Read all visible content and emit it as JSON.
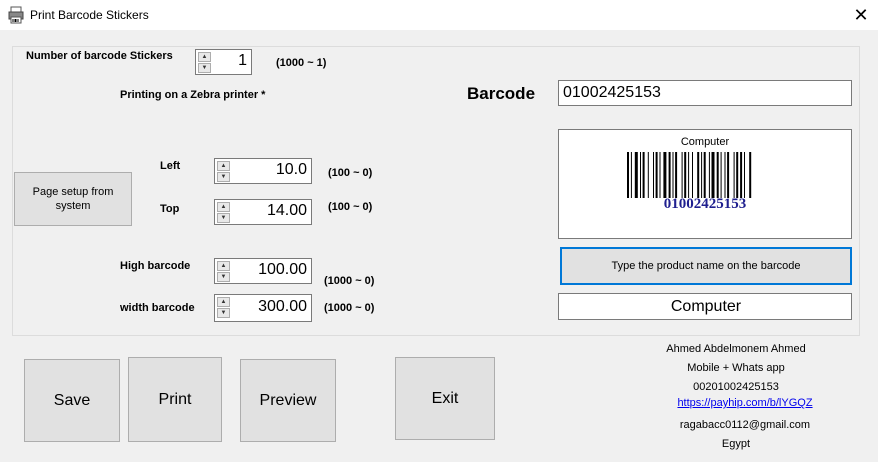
{
  "window": {
    "title": "Print Barcode Stickers",
    "close_glyph": "✕"
  },
  "icons": {
    "app": "printer-app-icon",
    "close": "close-icon",
    "spin_up": "▲",
    "spin_down": "▼"
  },
  "form": {
    "stickers_label": "Number of barcode Stickers",
    "stickers_value": "1",
    "stickers_range": "(1000 ~ 1)",
    "zebra_label": "Printing on a Zebra printer *",
    "page_setup_button": "Page setup from system",
    "left_label": "Left",
    "left_value": "10.0",
    "left_range": "(100 ~ 0)",
    "top_label": "Top",
    "top_value": "14.00",
    "top_range": "(100 ~ 0)",
    "high_label": "High barcode",
    "high_value": "100.00",
    "high_range": "(1000 ~ 0)",
    "width_label": "width barcode",
    "width_value": "300.00",
    "width_range": "(1000 ~ 0)"
  },
  "barcode": {
    "label": "Barcode",
    "value": "01002425153",
    "preview_name": "Computer",
    "preview_number": "01002425153",
    "type_name_button": "Type the product name on the barcode",
    "product_name_value": "Computer"
  },
  "buttons": {
    "save": "Save",
    "print": "Print",
    "preview": "Preview",
    "exit": "Exit"
  },
  "contact": {
    "name": "Ahmed Abdelmonem Ahmed",
    "mobile_label": "Mobile + Whats app",
    "phone": "00201002425153",
    "link": "https://payhip.com/b/lYGQZ",
    "email": "ragabacc0112@gmail.com",
    "country": "Egypt"
  },
  "colors": {
    "barcode_number": "#1f1f8f",
    "focus_border": "#0078d7",
    "link": "#0000ee"
  }
}
